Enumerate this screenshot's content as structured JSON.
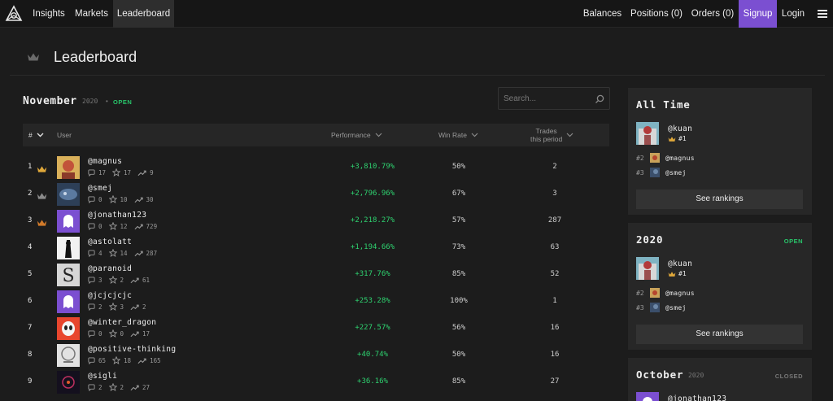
{
  "nav": {
    "logo": "logo-icon",
    "left": [
      "Insights",
      "Markets",
      "Leaderboard"
    ],
    "balances": "Balances",
    "positions": "Positions (0)",
    "orders": "Orders (0)",
    "signup": "Signup",
    "login": "Login"
  },
  "header": {
    "title": "Leaderboard"
  },
  "period": {
    "month": "November",
    "year": "2020",
    "sep": "•",
    "status": "OPEN"
  },
  "search": {
    "placeholder": "Search..."
  },
  "table": {
    "headers": {
      "rank": "#",
      "user": "User",
      "performance": "Performance",
      "winrate": "Win Rate",
      "trades_line1": "Trades",
      "trades_line2": "this period"
    },
    "rows": [
      {
        "rank": "1",
        "crown": "gold",
        "name": "@magnus",
        "comments": "17",
        "stars": "17",
        "trades": "9",
        "performance": "+3,810.79%",
        "winrate": "50%",
        "period_trades": "2"
      },
      {
        "rank": "2",
        "crown": "silver",
        "name": "@smej",
        "comments": "0",
        "stars": "10",
        "trades": "30",
        "performance": "+2,796.96%",
        "winrate": "67%",
        "period_trades": "3"
      },
      {
        "rank": "3",
        "crown": "bronze",
        "name": "@jonathan123",
        "comments": "0",
        "stars": "12",
        "trades": "729",
        "performance": "+2,218.27%",
        "winrate": "57%",
        "period_trades": "287"
      },
      {
        "rank": "4",
        "crown": "",
        "name": "@astolatt",
        "comments": "4",
        "stars": "14",
        "trades": "287",
        "performance": "+1,194.66%",
        "winrate": "73%",
        "period_trades": "63"
      },
      {
        "rank": "5",
        "crown": "",
        "name": "@paranoid",
        "comments": "3",
        "stars": "2",
        "trades": "61",
        "performance": "+317.76%",
        "winrate": "85%",
        "period_trades": "52"
      },
      {
        "rank": "6",
        "crown": "",
        "name": "@jcjcjcjc",
        "comments": "2",
        "stars": "3",
        "trades": "2",
        "performance": "+253.28%",
        "winrate": "100%",
        "period_trades": "1"
      },
      {
        "rank": "7",
        "crown": "",
        "name": "@winter_dragon",
        "comments": "0",
        "stars": "0",
        "trades": "17",
        "performance": "+227.57%",
        "winrate": "56%",
        "period_trades": "16"
      },
      {
        "rank": "8",
        "crown": "",
        "name": "@positive-thinking",
        "comments": "65",
        "stars": "18",
        "trades": "165",
        "performance": "+40.74%",
        "winrate": "50%",
        "period_trades": "16"
      },
      {
        "rank": "9",
        "crown": "",
        "name": "@sigli",
        "comments": "2",
        "stars": "2",
        "trades": "27",
        "performance": "+36.16%",
        "winrate": "85%",
        "period_trades": "27"
      }
    ]
  },
  "cards": {
    "all_time": {
      "title": "All Time",
      "leader_name": "@kuan",
      "leader_rank": "#1",
      "others": [
        {
          "rank": "#2",
          "name": "@magnus"
        },
        {
          "rank": "#3",
          "name": "@smej"
        }
      ],
      "button": "See rankings"
    },
    "year": {
      "title": "2020",
      "status": "OPEN",
      "leader_name": "@kuan",
      "leader_rank": "#1",
      "others": [
        {
          "rank": "#2",
          "name": "@magnus"
        },
        {
          "rank": "#3",
          "name": "@smej"
        }
      ],
      "button": "See rankings"
    },
    "october": {
      "title": "October",
      "year": "2020",
      "status": "CLOSED",
      "leader_name": "@jonathan123"
    }
  },
  "colors": {
    "accent": "#7b4fd1",
    "positive": "#2ed16f",
    "open": "#29c46a",
    "gold": "#e0a83a",
    "silver": "#8a8a8a",
    "bronze": "#d07a2a"
  }
}
